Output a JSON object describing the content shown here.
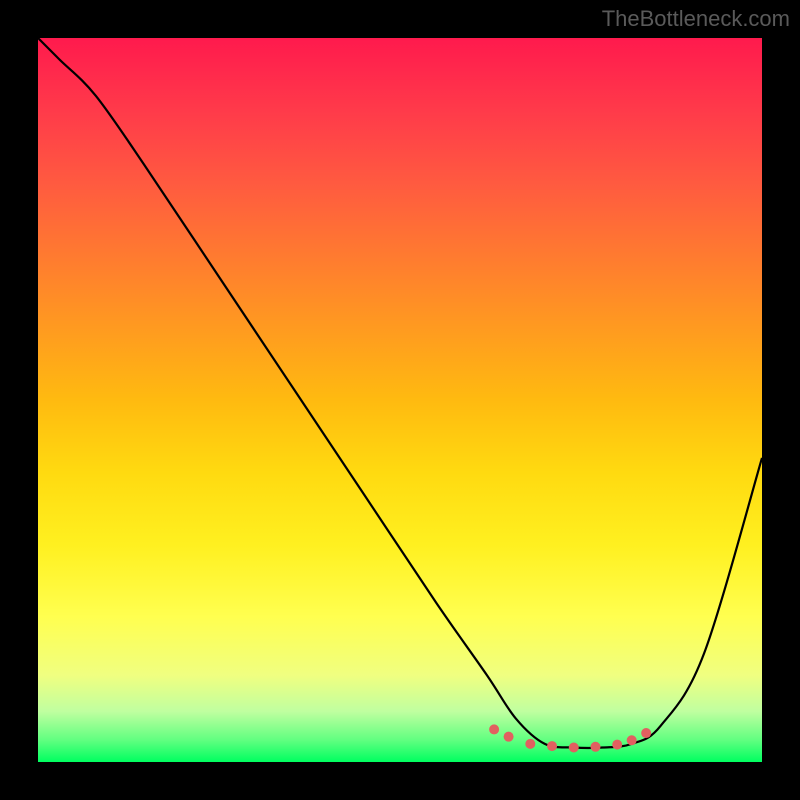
{
  "watermark": "TheBottleneck.com",
  "chart_data": {
    "type": "line",
    "title": "",
    "xlabel": "",
    "ylabel": "",
    "xlim": [
      0,
      100
    ],
    "ylim": [
      0,
      100
    ],
    "series": [
      {
        "name": "main-curve",
        "color": "#000000",
        "x": [
          0,
          3,
          8,
          15,
          25,
          35,
          45,
          55,
          62,
          66,
          70,
          74,
          78,
          82,
          86,
          92,
          100
        ],
        "y": [
          100,
          97,
          92,
          82,
          67,
          52,
          37,
          22,
          12,
          6,
          2.5,
          2,
          2,
          2.5,
          5,
          15,
          42
        ]
      },
      {
        "name": "highlight-dots",
        "color": "#e16060",
        "style": "markers",
        "x": [
          63,
          65,
          68,
          71,
          74,
          77,
          80,
          82,
          84
        ],
        "y": [
          4.5,
          3.5,
          2.5,
          2.2,
          2.0,
          2.1,
          2.4,
          3.0,
          4.0
        ]
      }
    ]
  }
}
